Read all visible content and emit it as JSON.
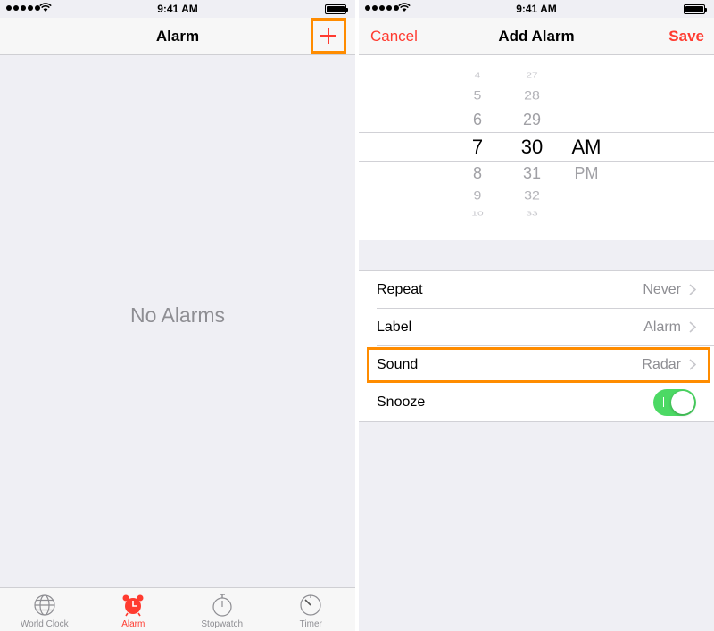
{
  "status_bar": {
    "time": "9:41 AM"
  },
  "alarm_screen": {
    "title": "Alarm",
    "add_icon": "plus-icon",
    "empty_message": "No Alarms",
    "tabs": [
      {
        "label": "World Clock",
        "icon": "globe-icon",
        "active": false
      },
      {
        "label": "Alarm",
        "icon": "alarm-clock-icon",
        "active": true
      },
      {
        "label": "Stopwatch",
        "icon": "stopwatch-icon",
        "active": false
      },
      {
        "label": "Timer",
        "icon": "timer-icon",
        "active": false
      }
    ]
  },
  "add_alarm_screen": {
    "title": "Add Alarm",
    "cancel_label": "Cancel",
    "save_label": "Save",
    "picker": {
      "hours": [
        "4",
        "5",
        "6",
        "7",
        "8",
        "9",
        "10"
      ],
      "minutes": [
        "27",
        "28",
        "29",
        "30",
        "31",
        "32",
        "33"
      ],
      "periods": [
        "AM",
        "PM"
      ],
      "selected": {
        "hour": "7",
        "minute": "30",
        "period": "AM"
      }
    },
    "settings": [
      {
        "label": "Repeat",
        "value": "Never"
      },
      {
        "label": "Label",
        "value": "Alarm"
      },
      {
        "label": "Sound",
        "value": "Radar"
      },
      {
        "label": "Snooze",
        "toggle_on": true
      }
    ]
  },
  "colors": {
    "accent": "#ff3b30",
    "highlight_box": "#ff8c00",
    "toggle_on": "#4cd964",
    "secondary_text": "#8e8e93"
  }
}
